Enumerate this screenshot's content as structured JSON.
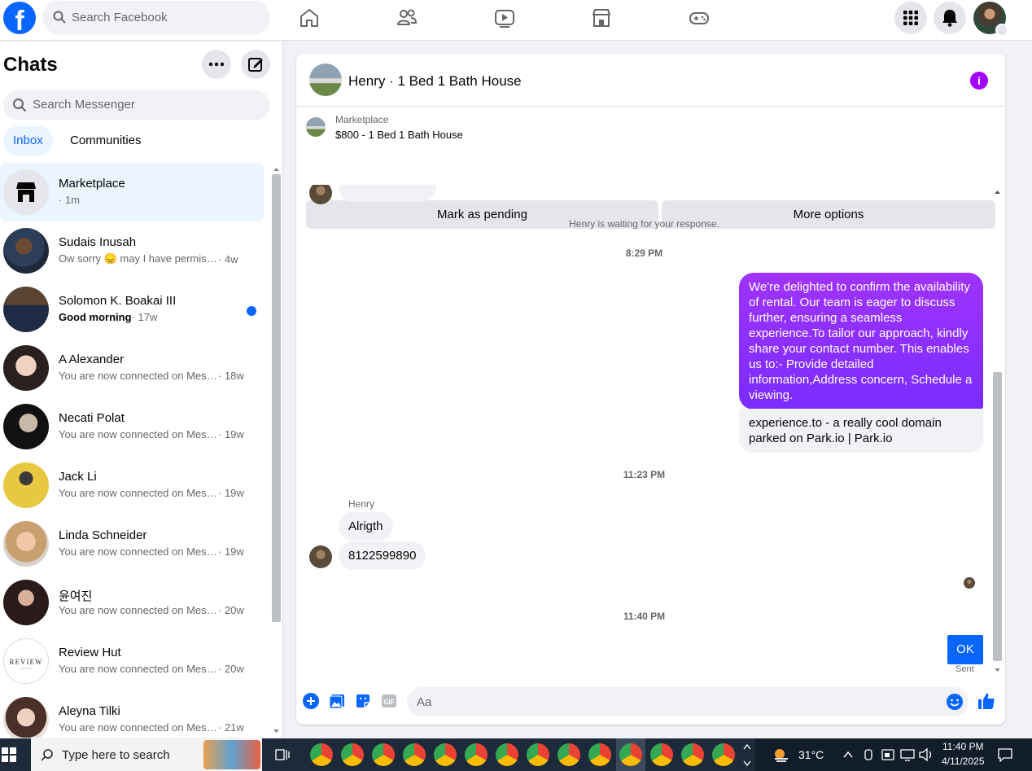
{
  "topbar": {
    "logo": "f",
    "search_placeholder": "Search Facebook",
    "nav_icons": [
      "home-icon",
      "friends-icon",
      "watch-icon",
      "marketplace-icon",
      "gaming-icon"
    ],
    "right_icons": [
      "menu-grid-icon",
      "bell-icon"
    ]
  },
  "sidebar": {
    "title": "Chats",
    "search_placeholder": "Search Messenger",
    "tabs": [
      {
        "label": "Inbox",
        "active": true
      },
      {
        "label": "Communities",
        "active": false
      }
    ],
    "chats": [
      {
        "name": "Marketplace",
        "preview": "",
        "time": "· 1m",
        "selected": true,
        "unread": false
      },
      {
        "name": "Sudais Inusah",
        "preview": "Ow sorry 😞 may I have permission to...",
        "time": "· 4w",
        "selected": false,
        "unread": false
      },
      {
        "name": "Solomon K. Boakai III",
        "preview": "Good morning",
        "time": "· 17w",
        "selected": false,
        "unread": true
      },
      {
        "name": "A Alexander",
        "preview": "You are now connected on Messenger",
        "time": "· 18w",
        "selected": false,
        "unread": false
      },
      {
        "name": "Necati Polat",
        "preview": "You are now connected on Messenger",
        "time": "· 19w",
        "selected": false,
        "unread": false
      },
      {
        "name": "Jack Li",
        "preview": "You are now connected on Messenger",
        "time": "· 19w",
        "selected": false,
        "unread": false
      },
      {
        "name": "Linda Schneider",
        "preview": "You are now connected on Messenger",
        "time": "· 19w",
        "selected": false,
        "unread": false
      },
      {
        "name": "윤여진",
        "preview": "You are now connected on Messenger",
        "time": "· 20w",
        "selected": false,
        "unread": false
      },
      {
        "name": "Review Hut",
        "preview": "You are now connected on Messenger",
        "time": "· 20w",
        "selected": false,
        "unread": false
      },
      {
        "name": "Aleyna Tilki",
        "preview": "You are now connected on Messenger",
        "time": "· 21w",
        "selected": false,
        "unread": false
      }
    ]
  },
  "conversation": {
    "title": "Henry · 1 Bed 1 Bath House",
    "marketplace_label": "Marketplace",
    "listing": "$800 - 1 Bed 1 Bath House",
    "mark_pending": "Mark as pending",
    "more_options": "More options",
    "waiting_note": "Henry is waiting for your response.",
    "time1": "8:29 PM",
    "outgoing_message": "We're delighted to confirm the availability of rental. Our team is eager to discuss further, ensuring a seamless experience.To tailor our approach, kindly share your contact number. This enables us to:- Provide detailed information,Address concern, Schedule a viewing.",
    "link_preview": "experience.to - a really cool domain parked on Park.io | Park.io",
    "time2": "11:23 PM",
    "sender": "Henry",
    "incoming": [
      "Alrigth",
      "8122599890"
    ],
    "time3": "11:40 PM",
    "ok_message": "OK",
    "sent_status": "Sent",
    "input_placeholder": "Aa",
    "input_value": "",
    "accent": "#0866ff",
    "bubble_color": "#8a2cff"
  },
  "taskbar": {
    "search_placeholder": "Type here to search",
    "weather": "31°C",
    "time": "11:40 PM",
    "date": "4/11/2025"
  }
}
